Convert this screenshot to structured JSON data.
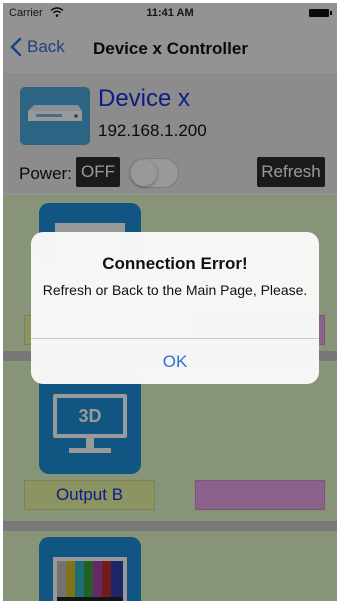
{
  "status_bar": {
    "carrier": "Carrier",
    "time": "11:41 AM",
    "wifi_icon": "wifi-icon",
    "battery_icon": "battery-icon"
  },
  "nav_bar": {
    "back_label": "Back",
    "title": "Device x Controller"
  },
  "device": {
    "name": "Device x",
    "ip": "192.168.1.200",
    "icon": "device-rack-icon"
  },
  "power": {
    "label": "Power:",
    "state": "OFF",
    "toggle_on": false
  },
  "refresh_label": "Refresh",
  "outputs": [
    {
      "tile_icon": "monitor-icon",
      "label": "",
      "color": "#e9a3ea"
    },
    {
      "tile_icon": "3d-monitor-icon",
      "label": "Output B",
      "tile_text": "3D",
      "color": "#e9a3ea"
    },
    {
      "tile_icon": "color-bars-monitor-icon",
      "label": ""
    }
  ],
  "alert": {
    "title": "Connection Error!",
    "message": "Refresh or Back to the Main Page, Please.",
    "ok_label": "OK"
  },
  "colors": {
    "accent": "#2f6fdb",
    "device_name": "#1a2fe0",
    "section_bg": "#e3f7c8",
    "tile": "#1d8fd9",
    "label_bg": "#e9f7a2",
    "field": "#e9a3ea"
  }
}
